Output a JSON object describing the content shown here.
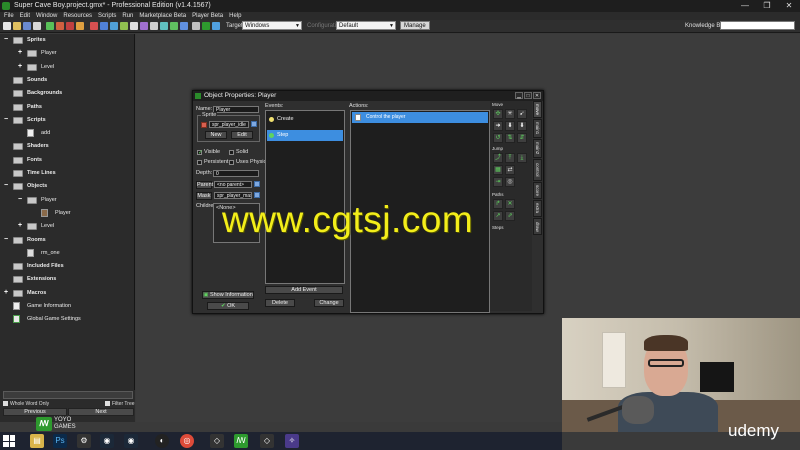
{
  "window": {
    "title": "Super Cave Boy.project.gmx* - Professional Edition (v1.4.1567)",
    "controls": [
      "—",
      "❐",
      "✕"
    ]
  },
  "menu": [
    "File",
    "Edit",
    "Window",
    "Resources",
    "Scripts",
    "Run",
    "Marketplace Beta",
    "Player Beta",
    "Help"
  ],
  "toolbar": {
    "target_label": "Target:",
    "target_value": "Windows",
    "configuration_label": "Configuration:",
    "configuration_value": "Default",
    "manage_label": "Manage",
    "knowledge_base_label": "Knowledge Base:"
  },
  "tree": {
    "items": [
      {
        "label": "Sprites",
        "kind": "folder",
        "bold": true
      },
      {
        "label": "Player",
        "kind": "folder"
      },
      {
        "label": "Level",
        "kind": "folder"
      },
      {
        "label": "Sounds",
        "kind": "folder",
        "bold": true
      },
      {
        "label": "Backgrounds",
        "kind": "folder",
        "bold": true
      },
      {
        "label": "Paths",
        "kind": "folder",
        "bold": true
      },
      {
        "label": "Scripts",
        "kind": "folder",
        "bold": true
      },
      {
        "label": "add",
        "kind": "script"
      },
      {
        "label": "Shaders",
        "kind": "folder",
        "bold": true
      },
      {
        "label": "Fonts",
        "kind": "folder",
        "bold": true
      },
      {
        "label": "Time Lines",
        "kind": "folder",
        "bold": true
      },
      {
        "label": "Objects",
        "kind": "folder",
        "bold": true
      },
      {
        "label": "Player",
        "kind": "folder"
      },
      {
        "label": "Player",
        "kind": "object"
      },
      {
        "label": "Level",
        "kind": "folder"
      },
      {
        "label": "Rooms",
        "kind": "folder",
        "bold": true
      },
      {
        "label": "rm_one",
        "kind": "room"
      },
      {
        "label": "Included Files",
        "kind": "folder",
        "bold": true
      },
      {
        "label": "Extensions",
        "kind": "folder",
        "bold": true
      },
      {
        "label": "Macros",
        "kind": "folder",
        "bold": true
      },
      {
        "label": "Game Information",
        "kind": "info"
      },
      {
        "label": "Global Game Settings",
        "kind": "settings"
      }
    ],
    "whole_word_label": "Whole Word Only",
    "filter_tree_label": "Filter Tree",
    "previous_label": "Previous",
    "next_label": "Next"
  },
  "dialog": {
    "title": "Object Properties: Player",
    "name_label": "Name:",
    "name_value": "Player",
    "sprite_group_label": "Sprite",
    "sprite_value": "spr_player_idle",
    "new_label": "New",
    "edit_label": "Edit",
    "visible_label": "Visible",
    "solid_label": "Solid",
    "persistent_label": "Persistent",
    "physics_label": "Uses Physics",
    "depth_label": "Depth:",
    "depth_value": "0",
    "parent_label": "Parent",
    "parent_value": "<no parent>",
    "mask_label": "Mask",
    "mask_value": "spr_player_mask",
    "children_label": "Children:",
    "children_value": "<None>",
    "show_info_label": "Show Information",
    "ok_label": "OK",
    "events_label": "Events:",
    "events": [
      {
        "label": "Create",
        "color": "#f0e070"
      },
      {
        "label": "Step",
        "color": "#5fd35f",
        "selected": true
      }
    ],
    "add_event_label": "Add Event",
    "delete_label": "Delete",
    "change_label": "Change",
    "actions_label": "Actions:",
    "actions": [
      "Control the player"
    ],
    "library_headings": [
      "Move",
      "Jump",
      "Paths",
      "Steps"
    ],
    "tabs": [
      "move",
      "main1",
      "main2",
      "control",
      "score",
      "extra",
      "draw"
    ]
  },
  "watermark": "www.cgtsj.com",
  "brand": {
    "yoyo_line1": "YOYO",
    "yoyo_line2": "GAMES",
    "udemy": "udemy"
  },
  "taskbar": {
    "icons": [
      "windows-explorer",
      "photoshop",
      "app",
      "steam",
      "steam2",
      "obs",
      "chrome",
      "unity",
      "gamemaker",
      "unity2",
      "app2",
      "gamemaker2"
    ]
  },
  "colors": {
    "selection": "#3d8ee0",
    "gm_green": "#2e9a2e",
    "watermark": "#f3ee1a"
  }
}
